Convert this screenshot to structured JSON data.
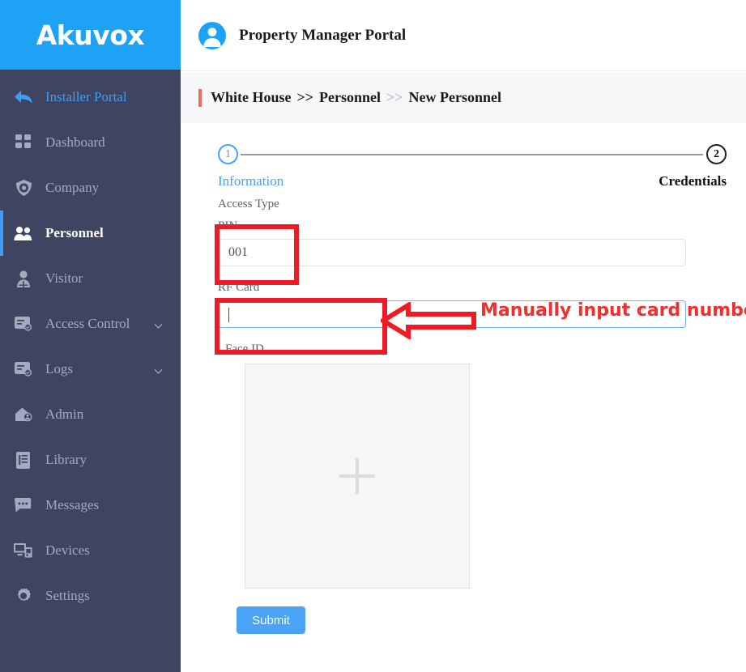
{
  "brand": {
    "name": "Akuvox",
    "color": "#1ea2f5"
  },
  "header": {
    "title": "Property Manager Portal",
    "avatar_icon": "user-avatar-icon"
  },
  "breadcrumb": {
    "accent_color": "#f4695f",
    "items": [
      "White House",
      "Personnel",
      "New Personnel"
    ],
    "separator_primary": ">>",
    "separator_secondary": ">>"
  },
  "sidebar": {
    "background": "#3f4461",
    "active_color": "#3f9df4",
    "portal_link": {
      "label": "Installer Portal",
      "icon": "back-arrow-icon"
    },
    "items": [
      {
        "label": "Dashboard",
        "icon": "dashboard-grid-icon",
        "active": false,
        "has_caret": false
      },
      {
        "label": "Company",
        "icon": "company-shield-icon",
        "active": false,
        "has_caret": false
      },
      {
        "label": "Personnel",
        "icon": "personnel-users-icon",
        "active": true,
        "has_caret": false
      },
      {
        "label": "Visitor",
        "icon": "visitor-person-icon",
        "active": false,
        "has_caret": false
      },
      {
        "label": "Access Control",
        "icon": "access-control-icon",
        "active": false,
        "has_caret": true
      },
      {
        "label": "Logs",
        "icon": "logs-icon",
        "active": false,
        "has_caret": true
      },
      {
        "label": "Admin",
        "icon": "admin-home-user-icon",
        "active": false,
        "has_caret": false
      },
      {
        "label": "Library",
        "icon": "library-book-icon",
        "active": false,
        "has_caret": false
      },
      {
        "label": "Messages",
        "icon": "messages-chat-icon",
        "active": false,
        "has_caret": false
      },
      {
        "label": "Devices",
        "icon": "devices-monitor-icon",
        "active": false,
        "has_caret": false
      },
      {
        "label": "Settings",
        "icon": "settings-gear-icon",
        "active": false,
        "has_caret": false
      }
    ]
  },
  "stepper": {
    "steps": [
      {
        "number": "1",
        "label": "Information",
        "state": "active",
        "color": "#49a2f7"
      },
      {
        "number": "2",
        "label": "Credentials",
        "state": "inactive",
        "color": "#111111"
      }
    ]
  },
  "form": {
    "section_label": "Access Type",
    "pin": {
      "label": "PIN",
      "value": "001",
      "placeholder": ""
    },
    "rf_card": {
      "label": "RF Card",
      "value": "",
      "placeholder": "",
      "focused": true
    },
    "face_id": {
      "label": "Face ID",
      "upload_icon": "plus-icon"
    },
    "submit_label": "Submit"
  },
  "annotations": {
    "color": "#ee1b24",
    "text_color": "#f03030",
    "callout_text": "Manually input card number",
    "arrow_icon": "left-arrow-outline-icon",
    "highlight_pin": true,
    "highlight_rf_card": true
  }
}
